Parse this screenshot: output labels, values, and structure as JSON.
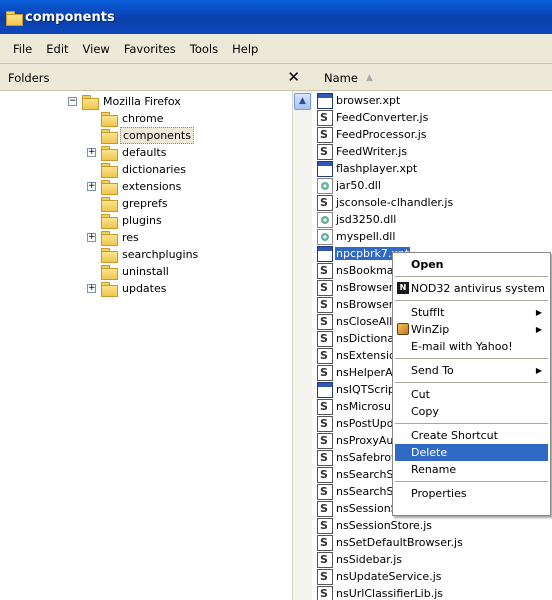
{
  "window": {
    "title": "components"
  },
  "menubar": [
    "File",
    "Edit",
    "View",
    "Favorites",
    "Tools",
    "Help"
  ],
  "folders_pane": {
    "header": "Folders",
    "close_glyph": "✕",
    "tree": [
      {
        "label": "Mozilla Firefox",
        "expander": "−",
        "level": 0
      },
      {
        "label": "chrome",
        "expander": "",
        "level": 1
      },
      {
        "label": "components",
        "expander": "",
        "level": 1,
        "selected": true
      },
      {
        "label": "defaults",
        "expander": "+",
        "level": 1
      },
      {
        "label": "dictionaries",
        "expander": "",
        "level": 1
      },
      {
        "label": "extensions",
        "expander": "+",
        "level": 1
      },
      {
        "label": "greprefs",
        "expander": "",
        "level": 1
      },
      {
        "label": "plugins",
        "expander": "",
        "level": 1
      },
      {
        "label": "res",
        "expander": "+",
        "level": 1
      },
      {
        "label": "searchplugins",
        "expander": "",
        "level": 1
      },
      {
        "label": "uninstall",
        "expander": "",
        "level": 1
      },
      {
        "label": "updates",
        "expander": "+",
        "level": 1
      }
    ]
  },
  "file_list": {
    "column_header": "Name",
    "files": [
      {
        "name": "browser.xpt",
        "icon": "window-icon"
      },
      {
        "name": "FeedConverter.js",
        "icon": "script-icon"
      },
      {
        "name": "FeedProcessor.js",
        "icon": "script-icon"
      },
      {
        "name": "FeedWriter.js",
        "icon": "script-icon"
      },
      {
        "name": "flashplayer.xpt",
        "icon": "window-icon"
      },
      {
        "name": "jar50.dll",
        "icon": "gear-icon"
      },
      {
        "name": "jsconsole-clhandler.js",
        "icon": "script-icon"
      },
      {
        "name": "jsd3250.dll",
        "icon": "gear-icon"
      },
      {
        "name": "myspell.dll",
        "icon": "gear-icon"
      },
      {
        "name": "npcpbrk7.xpt",
        "icon": "window-icon",
        "selected": true
      },
      {
        "name": "nsBookmark",
        "icon": "script-icon"
      },
      {
        "name": "nsBrowserC",
        "icon": "script-icon"
      },
      {
        "name": "nsBrowserG",
        "icon": "script-icon"
      },
      {
        "name": "nsCloseAllW",
        "icon": "script-icon"
      },
      {
        "name": "nsDictionary",
        "icon": "script-icon"
      },
      {
        "name": "nsExtension",
        "icon": "script-icon"
      },
      {
        "name": "nsHelperApp",
        "icon": "script-icon"
      },
      {
        "name": "nsIQTScript",
        "icon": "window-icon"
      },
      {
        "name": "nsMicrosum",
        "icon": "script-icon"
      },
      {
        "name": "nsPostUpda",
        "icon": "script-icon"
      },
      {
        "name": "nsProxyAut",
        "icon": "script-icon"
      },
      {
        "name": "nsSafebrow",
        "icon": "script-icon"
      },
      {
        "name": "nsSearchSe",
        "icon": "script-icon"
      },
      {
        "name": "nsSearchSu",
        "icon": "script-icon"
      },
      {
        "name": "nsSessionSt",
        "icon": "script-icon"
      },
      {
        "name": "nsSessionStore.js",
        "icon": "script-icon"
      },
      {
        "name": "nsSetDefaultBrowser.js",
        "icon": "script-icon"
      },
      {
        "name": "nsSidebar.js",
        "icon": "script-icon"
      },
      {
        "name": "nsUpdateService.js",
        "icon": "script-icon"
      },
      {
        "name": "nsUrlClassifierLib.js",
        "icon": "script-icon"
      }
    ]
  },
  "context_menu": {
    "items": [
      {
        "label": "Open",
        "bold": true
      },
      {
        "sep": true
      },
      {
        "label": "NOD32 antivirus system",
        "icon": "nod32-icon"
      },
      {
        "sep": true
      },
      {
        "label": "StuffIt",
        "submenu": true
      },
      {
        "label": "WinZip",
        "submenu": true,
        "icon": "winzip-icon"
      },
      {
        "label": "E-mail with Yahoo!"
      },
      {
        "sep": true
      },
      {
        "label": "Send To",
        "submenu": true
      },
      {
        "sep": true
      },
      {
        "label": "Cut"
      },
      {
        "label": "Copy"
      },
      {
        "sep": true
      },
      {
        "label": "Create Shortcut"
      },
      {
        "label": "Delete",
        "highlight": true
      },
      {
        "label": "Rename"
      },
      {
        "sep": true
      },
      {
        "label": "Properties"
      }
    ],
    "nod32_icon_text": "N"
  },
  "colors": {
    "selection": "#316ac5",
    "titlebar": "#0a52d0",
    "chrome": "#ece9d8"
  }
}
